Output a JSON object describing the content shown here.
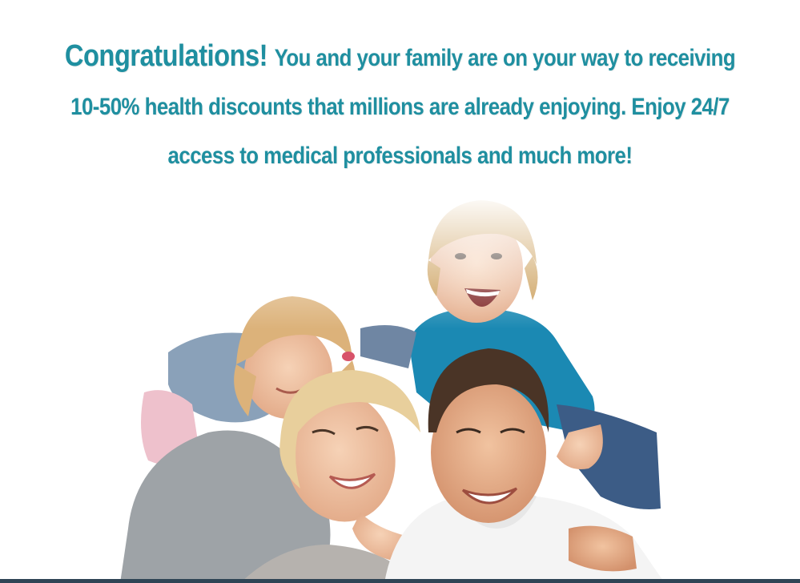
{
  "headline": {
    "lead": "Congratulations!",
    "line1": "You and your family are on your way to receiving",
    "line2": "10-50% health discounts that millions are already enjoying. Enjoy 24/7",
    "line3": "access to medical professionals and much more!"
  },
  "colors": {
    "headline": "#1f8fa0",
    "bottom_bar": "#2f4455"
  },
  "photo": {
    "subject": "family-photo"
  }
}
